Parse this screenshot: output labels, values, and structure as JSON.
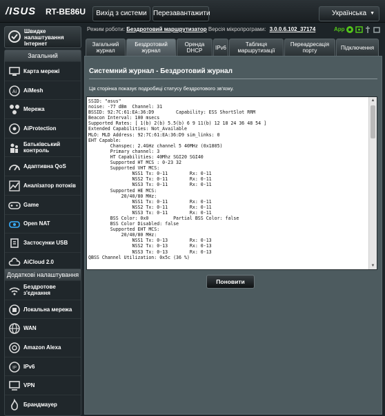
{
  "header": {
    "brand": "/ISUS",
    "model": "RT-BE86U",
    "logout_label": "Вихід з системи",
    "reboot_label": "Перезавантажити",
    "language": "Українська"
  },
  "sidebar": {
    "quick_setup": "Швидке налаштування Інтернет",
    "general": {
      "title": "Загальний",
      "items": [
        {
          "label": "Карта мережі",
          "icon": "network-map-icon"
        },
        {
          "label": "AiMesh",
          "icon": "aimesh-icon"
        },
        {
          "label": "Мережа",
          "icon": "network-icon"
        },
        {
          "label": "AiProtection",
          "icon": "aiprotection-icon"
        },
        {
          "label": "Батьківський контроль",
          "icon": "parental-control-icon"
        },
        {
          "label": "Адаптивна QoS",
          "icon": "qos-icon"
        },
        {
          "label": "Аналізатор потоків",
          "icon": "traffic-analyzer-icon"
        },
        {
          "label": "Game",
          "icon": "gamepad-icon"
        },
        {
          "label": "Open NAT",
          "icon": "open-nat-icon"
        },
        {
          "label": "Застосунки USB",
          "icon": "usb-icon"
        },
        {
          "label": "AiCloud 2.0",
          "icon": "cloud-icon"
        }
      ]
    },
    "advanced": {
      "title": "Додаткові налаштування",
      "items": [
        {
          "label": "Бездротове з'єднання",
          "icon": "wireless-icon"
        },
        {
          "label": "Локальна мережа",
          "icon": "lan-icon"
        },
        {
          "label": "WAN",
          "icon": "wan-icon"
        },
        {
          "label": "Amazon Alexa",
          "icon": "alexa-icon"
        },
        {
          "label": "IPv6",
          "icon": "ipv6-icon"
        },
        {
          "label": "VPN",
          "icon": "vpn-icon"
        },
        {
          "label": "Брандмауер",
          "icon": "firewall-icon"
        }
      ]
    }
  },
  "status": {
    "mode_label": "Режим роботи:",
    "mode_value": "Бездротовий маршрутизатор",
    "firmware_label": "Версія мікропрограми:",
    "firmware_value": "3.0.0.6.102_37174",
    "app_label": "App"
  },
  "tabs": [
    {
      "label": "Загальний журнал"
    },
    {
      "label": "Бездротовий журнал"
    },
    {
      "label": "Оренда DHCP"
    },
    {
      "label": "IPv6"
    },
    {
      "label": "Таблиця маршрутизації"
    },
    {
      "label": "Переадресація порту"
    },
    {
      "label": "Підключення"
    }
  ],
  "panel": {
    "title": "Системний журнал - Бездротовий журнал",
    "description": "Ця сторінка показує подробиці статусу бездротового зв'язку.",
    "refresh_label": "Поновити",
    "log_lines": [
      "SSID: \"asus\"",
      "noise: -77 dBm  Channel: 31",
      "BSSID: 92:7C:61:EA:36:D9        Capability: ESS ShortSlot RRM",
      "Beacon Interval: 100 msecs",
      "Supported Rates: [ 1(b) 2(b) 5.5(b) 6 9 11(b) 12 18 24 36 48 54 ]",
      "Extended Capabilities: Not_Available",
      "MLO: MLD Address: 92:7C:61:EA:36:D9 sim_links: 0",
      "EHT Capable:",
      "        Chanspec: 2.4GHz channel 5 40MHz (0x1805)",
      "        Primary channel: 3",
      "        HT Capabilities: 40Mhz SGI20 SGI40",
      "        Supported HT MCS : 0-23 32",
      "        Supported VHT MCS:",
      "                NSS1 Tx: 0-11        Rx: 0-11",
      "                NSS2 Tx: 0-11        Rx: 0-11",
      "                NSS3 Tx: 0-11        Rx: 0-11",
      "        Supported HE MCS:",
      "            20/40/80 MHz:",
      "                NSS1 Tx: 0-11        Rx: 0-11",
      "                NSS2 Tx: 0-11        Rx: 0-11",
      "                NSS3 Tx: 0-11        Rx: 0-11",
      "        BSS Color: 0x0         Partial BSS Color: false",
      "        BSS Color Disabled: false",
      "        Supported EHT MCS:",
      "            20/40/80 MHz:",
      "                NSS1 Tx: 0-13        Rx: 0-13",
      "                NSS2 Tx: 0-13        Rx: 0-13",
      "                NSS3 Tx: 0-13        Rx: 0-13",
      "QBSS Channel Utilization: 0x5c (36 %)"
    ]
  },
  "colors": {
    "background": "#1d2428",
    "panel": "#4d5b5f",
    "app_green": "#53c41a"
  }
}
